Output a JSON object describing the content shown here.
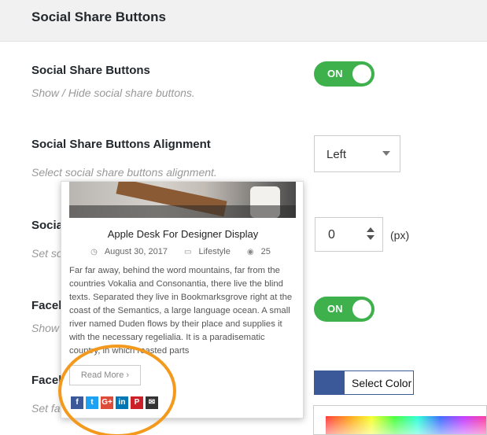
{
  "header": {
    "title": "Social Share Buttons"
  },
  "rows": [
    {
      "title": "Social Share Buttons",
      "desc": "Show / Hide social share buttons."
    },
    {
      "title": "Social Share Buttons Alignment",
      "desc": "Select social share buttons alignment."
    },
    {
      "title": "Socia",
      "desc": "Set so"
    },
    {
      "title": "Faceb",
      "desc": "Show"
    },
    {
      "title": "Faceb",
      "desc": "Set fa"
    }
  ],
  "toggles": {
    "share_buttons": "ON",
    "facebook": "ON"
  },
  "alignment_select": {
    "value": "Left"
  },
  "number_input": {
    "value": "0",
    "unit": "(px)"
  },
  "color_button": {
    "label": "Select Color",
    "swatch_color": "#3b5998"
  },
  "preview_card": {
    "title": "Apple Desk For Designer Display",
    "date": "August 30, 2017",
    "category": "Lifestyle",
    "views": "25",
    "body": "Far far away, behind the word mountains, far from the countries Vokalia and Consonantia, there live the blind texts. Separated they live in Bookmarksgrove right at the coast of the Semantics, a large language ocean. A small river named Duden flows by their place and supplies it with the necessary regelialia. It is a paradisematic country, in which roasted parts",
    "read_more": "Read More ›",
    "share_icons": [
      {
        "name": "facebook",
        "glyph": "f",
        "color": "#3b5998"
      },
      {
        "name": "twitter",
        "glyph": "t",
        "color": "#1da1f2"
      },
      {
        "name": "google-plus",
        "glyph": "G+",
        "color": "#dd4b39"
      },
      {
        "name": "linkedin",
        "glyph": "in",
        "color": "#0077b5"
      },
      {
        "name": "pinterest",
        "glyph": "P",
        "color": "#cb2027"
      },
      {
        "name": "email",
        "glyph": "✉",
        "color": "#333333"
      }
    ]
  },
  "colors": {
    "toggle_on": "#3eb14d",
    "highlight": "#f39a1e"
  }
}
